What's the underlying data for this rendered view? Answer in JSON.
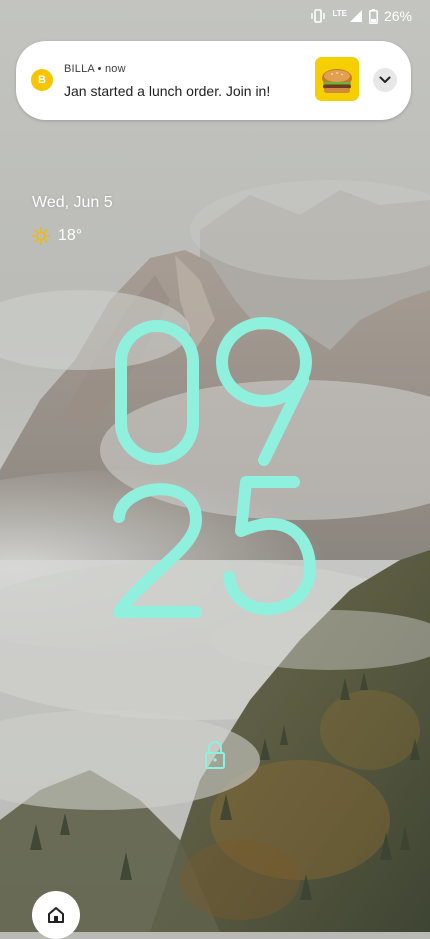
{
  "status_bar": {
    "network_label": "LTE",
    "battery": "26%",
    "icons": [
      "vibrate-icon",
      "signal-icon",
      "battery-icon"
    ]
  },
  "notification": {
    "app_initial": "B",
    "app_name": "BILLA",
    "time": "now",
    "message": "Jan started a lunch order. Join in!",
    "thumbnail": "burger-image",
    "expand_icon": "chevron-down-icon"
  },
  "lockscreen": {
    "date": "Wed, Jun 5",
    "weather_icon": "sun-icon",
    "temperature": "18°",
    "clock": {
      "hours": "09",
      "minutes": "25"
    },
    "lock_icon": "lock-icon",
    "home_icon": "home-icon"
  },
  "colors": {
    "clock": "#8ff0de",
    "notification_badge": "#f6c400",
    "sun": "#f5b800"
  }
}
